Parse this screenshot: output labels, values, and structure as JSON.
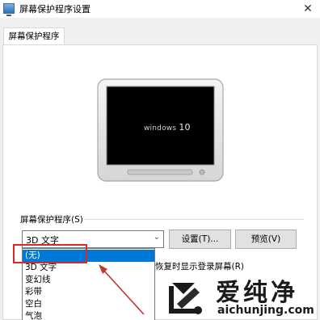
{
  "window": {
    "title": "屏幕保护程序设置",
    "close_icon": "close-icon"
  },
  "tabs": [
    {
      "label": "屏幕保护程序"
    }
  ],
  "preview": {
    "screen_text_small": "windows",
    "screen_text_big": "10"
  },
  "screensaver": {
    "group_label": "屏幕保护程序(S)",
    "selected_value": "3D 文字",
    "settings_button": "设置(T)...",
    "preview_button": "预览(V)",
    "resume_text": "恢复时显示登录屏幕(R)",
    "options": [
      "(无)",
      "3D 文字",
      "变幻线",
      "彩带",
      "空白",
      "气泡"
    ],
    "highlighted_option_index": 0
  },
  "colors": {
    "selection": "#0078d7",
    "highlight_box": "#d42a2a",
    "arrow": "#c0392b"
  },
  "watermark": {
    "name": "爱纯净",
    "url": "aichunjing.com"
  }
}
